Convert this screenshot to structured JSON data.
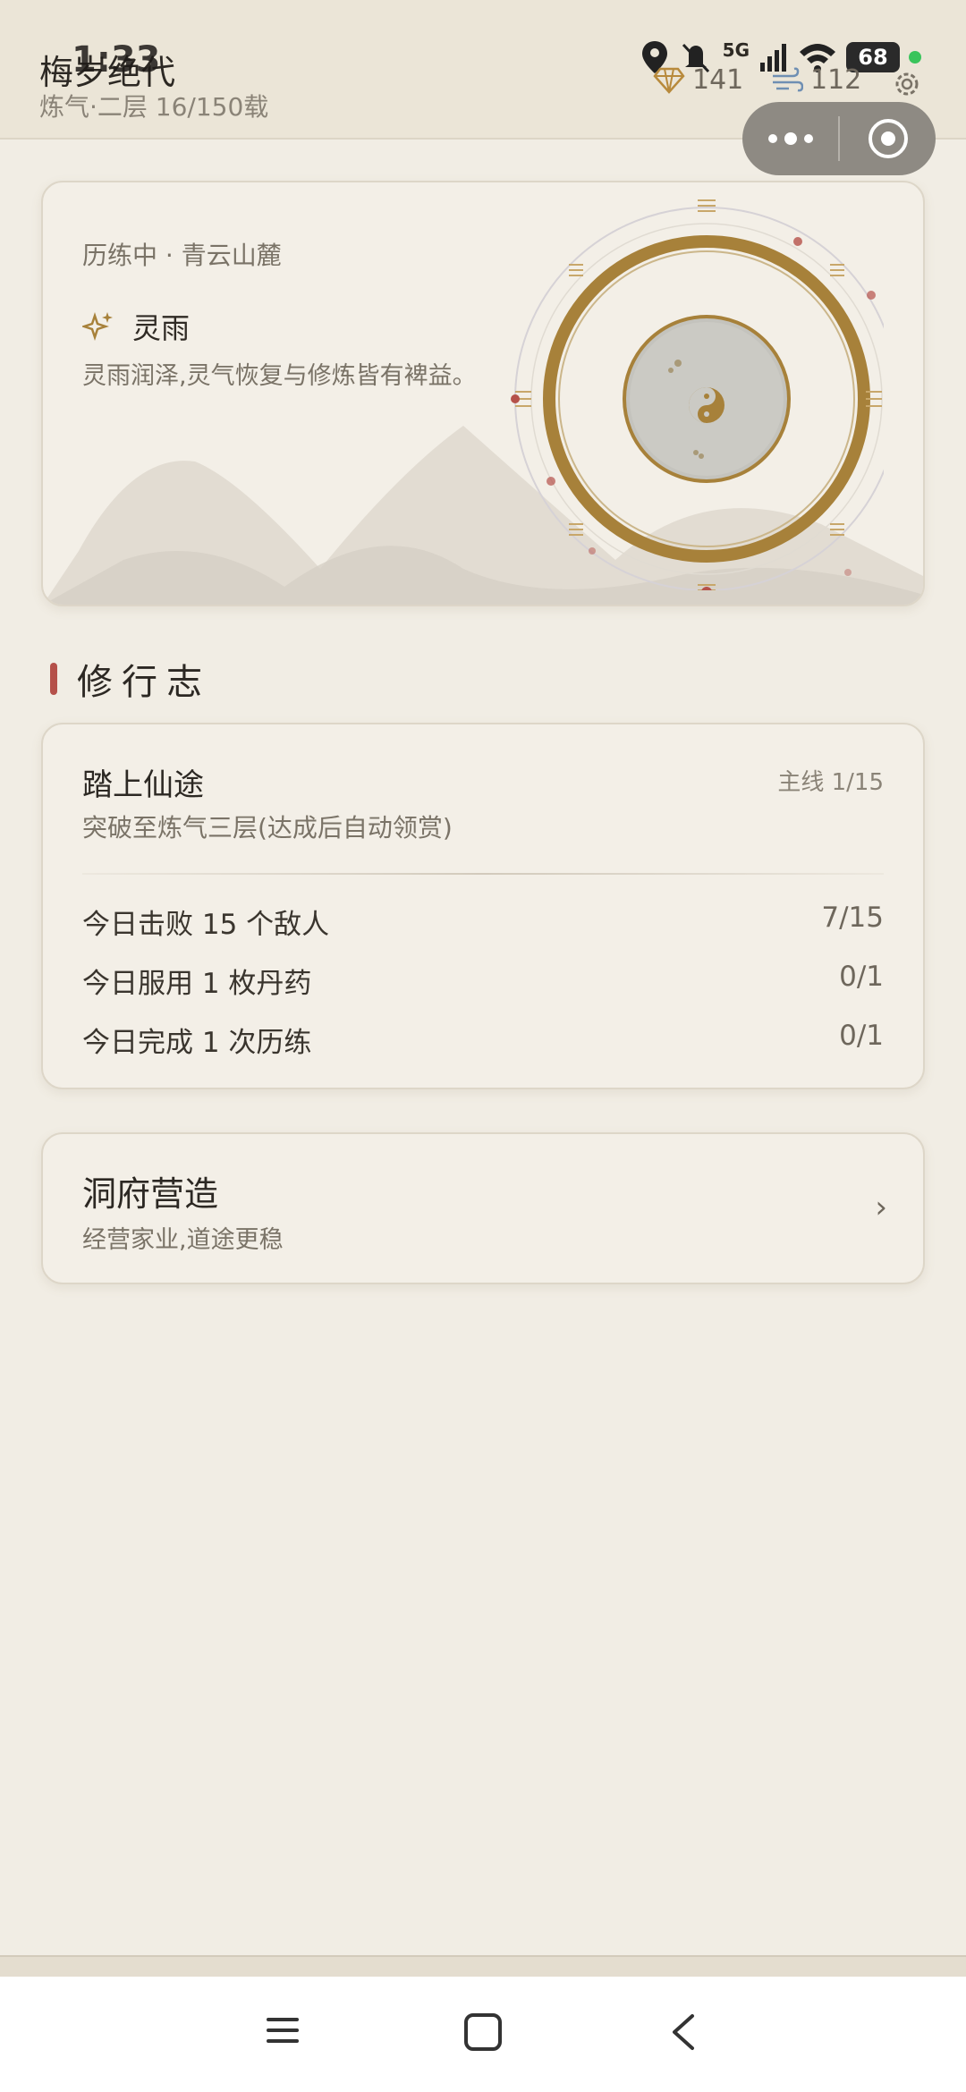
{
  "status_bar": {
    "time": "1:33",
    "network": "5G",
    "battery": "68"
  },
  "header": {
    "app_title": "梅岁绝代",
    "realm_text": "炼气·二层  16/150载",
    "gems": "141",
    "spirit": "112"
  },
  "scene_card": {
    "status_text": "历练中 · 青云山麓",
    "weather_name": "灵雨",
    "weather_desc": "灵雨润泽,灵气恢复与修炼皆有裨益。"
  },
  "section": {
    "title": "修行志"
  },
  "main_quest": {
    "title": "踏上仙途",
    "tag": "主线 1/15",
    "description": "突破至炼气三层(达成后自动领赏)"
  },
  "daily_tasks": [
    {
      "label": "今日击败 15 个敌人",
      "progress": "7/15"
    },
    {
      "label": "今日服用 1 枚丹药",
      "progress": "0/1"
    },
    {
      "label": "今日完成 1 次历练",
      "progress": "0/1"
    }
  ],
  "cave_card": {
    "title": "洞府营造",
    "subtitle": "经营家业,道途更稳",
    "chevron": "›"
  },
  "colors": {
    "accent_red": "#b5514a",
    "gold": "#a7813a",
    "background": "#f1ede4"
  },
  "icons": [
    "location-icon",
    "mute-icon",
    "signal-icon",
    "wifi-icon",
    "gem-icon",
    "wind-icon",
    "gear-icon",
    "more-icon",
    "target-icon",
    "sparkle-icon",
    "menu-icon",
    "home-icon",
    "back-icon"
  ]
}
